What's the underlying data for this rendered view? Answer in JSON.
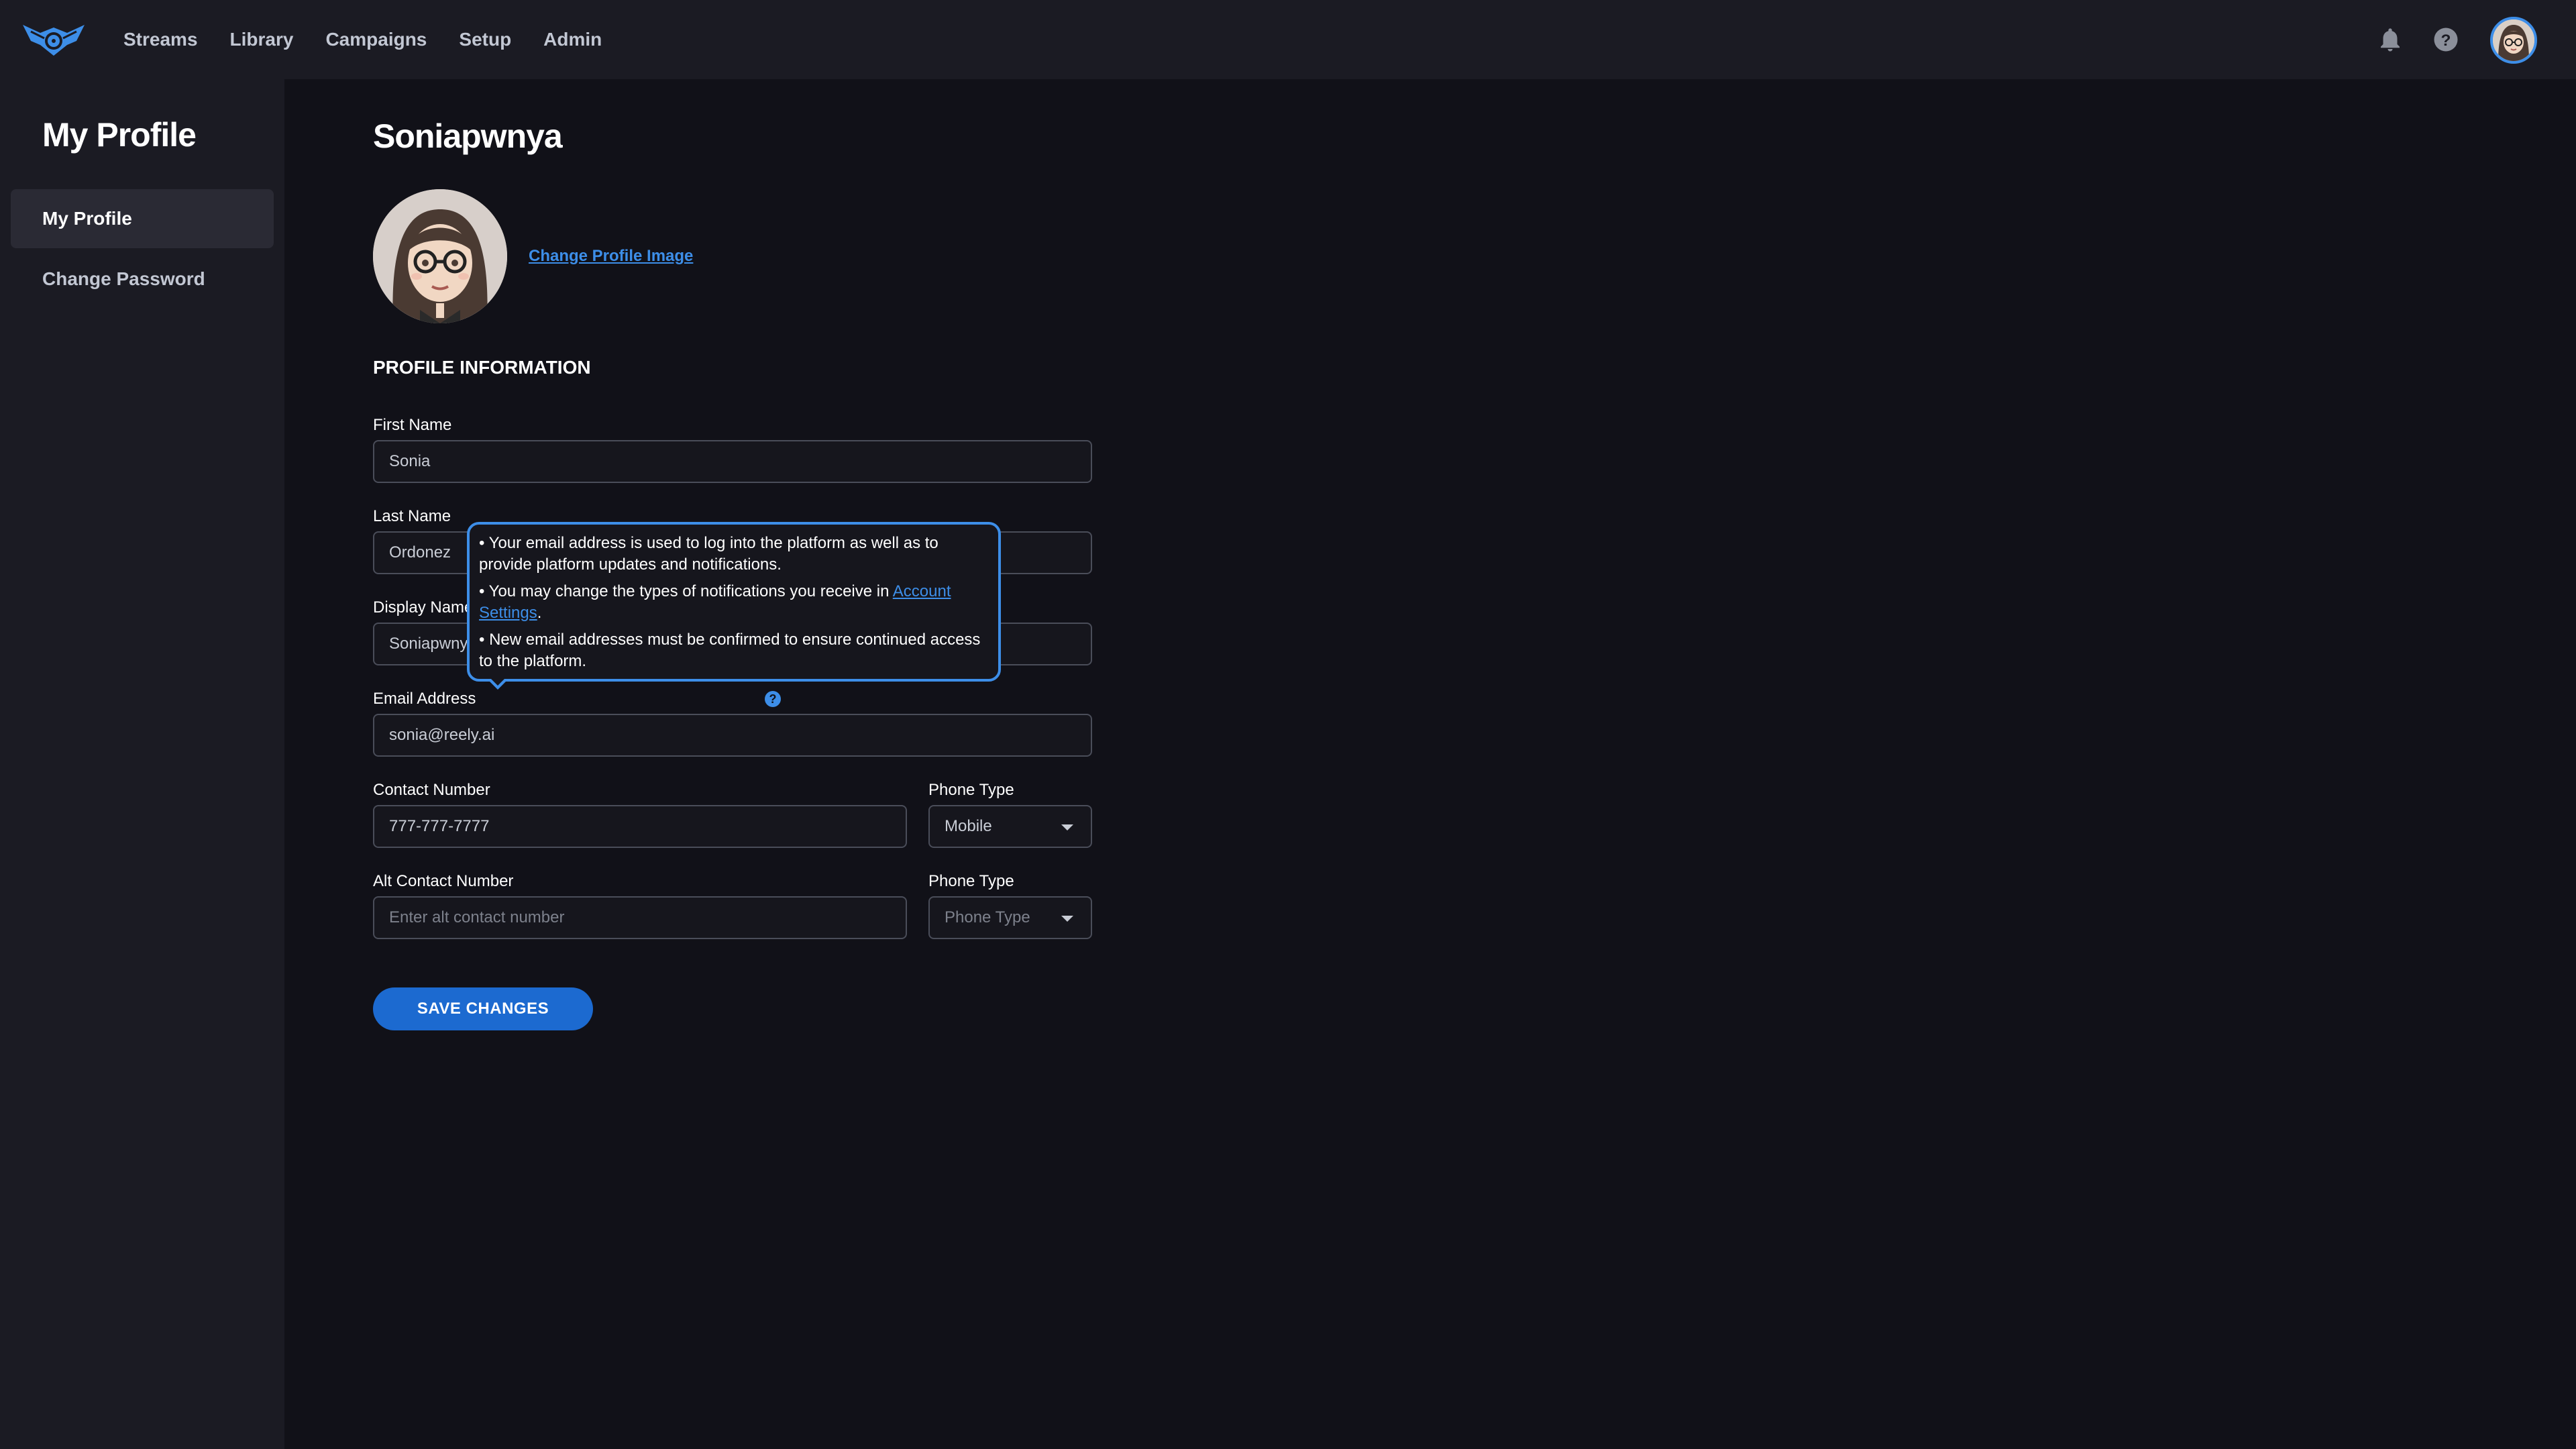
{
  "nav": {
    "items": [
      "Streams",
      "Library",
      "Campaigns",
      "Setup",
      "Admin"
    ],
    "icons": [
      "bell-icon",
      "help-icon"
    ]
  },
  "sidebar": {
    "title": "My Profile",
    "items": [
      {
        "label": "My Profile",
        "active": true
      },
      {
        "label": "Change Password",
        "active": false
      }
    ]
  },
  "main": {
    "title": "Soniapwnya",
    "change_image_link": "Change Profile Image",
    "section_heading": "PROFILE INFORMATION",
    "fields": {
      "first_name": {
        "label": "First Name",
        "value": "Sonia"
      },
      "last_name": {
        "label": "Last Name",
        "value": "Ordonez"
      },
      "display_name": {
        "label": "Display Name",
        "value": "Soniapwnya"
      },
      "email": {
        "label": "Email Address",
        "value": "sonia@reely.ai"
      },
      "contact": {
        "label": "Contact Number",
        "value": "777-777-7777"
      },
      "phone_type_1": {
        "label": "Phone Type",
        "value": "Mobile"
      },
      "alt_contact": {
        "label": "Alt Contact Number",
        "placeholder": "Enter alt contact number"
      },
      "phone_type_2": {
        "label": "Phone Type",
        "placeholder": "Phone Type"
      }
    },
    "save_button": "SAVE CHANGES"
  },
  "tooltip": {
    "line1": "• Your email address is used to log into the platform as well as to provide platform updates and notifications.",
    "line2_prefix": "• You may change the types of notifications you receive in ",
    "line2_link": "Account Settings",
    "line2_suffix": ".",
    "line3": "• New email addresses must be confirmed to ensure continued access to the platform."
  },
  "colors": {
    "accent": "#3d8ee8",
    "button": "#1c6ad0",
    "background": "#111118",
    "panel": "#1b1b23"
  }
}
